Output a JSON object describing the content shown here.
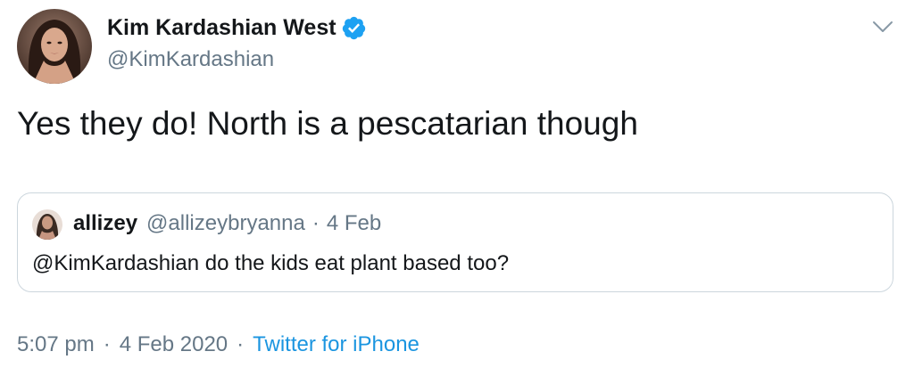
{
  "author": {
    "display_name": "Kim Kardashian West",
    "handle": "@KimKardashian",
    "verified_icon": "verified-badge-icon",
    "avatar_icon": "avatar"
  },
  "tweet": {
    "text": "Yes they do! North is a pescatarian though"
  },
  "quoted_tweet": {
    "display_name": "allizey",
    "handle": "@allizeybryanna",
    "separator": "·",
    "date": "4 Feb",
    "text": "@KimKardashian do the kids eat plant based too?"
  },
  "meta": {
    "time": "5:07 pm",
    "separator": "·",
    "date": "4 Feb 2020",
    "source": "Twitter for iPhone"
  },
  "menu": {
    "icon": "chevron-down-icon"
  },
  "colors": {
    "text_primary": "#14171a",
    "text_secondary": "#657786",
    "link": "#1b95e0",
    "verified": "#1da1f2",
    "border": "#ccd6dd"
  }
}
